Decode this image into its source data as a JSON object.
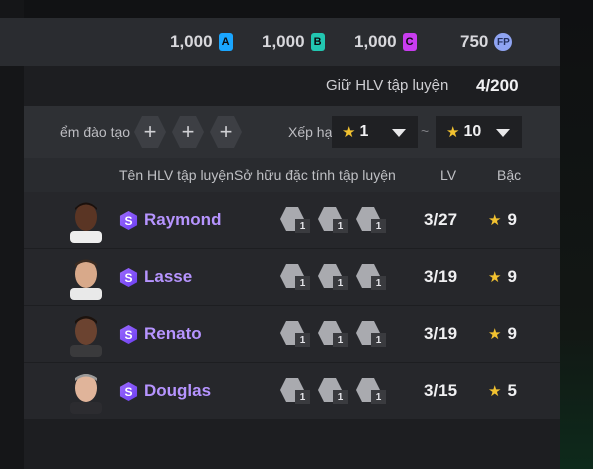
{
  "currencies": [
    {
      "amount": "1,000",
      "badge": "A"
    },
    {
      "amount": "1,000",
      "badge": "B"
    },
    {
      "amount": "1,000",
      "badge": "C"
    },
    {
      "amount": "750",
      "badge": "FP"
    }
  ],
  "hold": {
    "label": "Giữ HLV tập luyện",
    "count": "4/200"
  },
  "filter": {
    "training_slots_label": "ểm đào tạo",
    "plus": "+",
    "sort_label": "Xếp hạ",
    "min": "1",
    "max": "10",
    "tilde": "~",
    "star": "★"
  },
  "headers": {
    "name": "Tên HLV tập luyện",
    "traits": "Sở hữu đặc tính tập luyện",
    "lv": "LV",
    "grade": "Bậc"
  },
  "coaches": [
    {
      "badge": "S",
      "name": "Raymond",
      "lv": "3/27",
      "grade": "9",
      "traits": [
        "1",
        "1",
        "1"
      ]
    },
    {
      "badge": "S",
      "name": "Lasse",
      "lv": "3/19",
      "grade": "9",
      "traits": [
        "1",
        "1",
        "1"
      ]
    },
    {
      "badge": "S",
      "name": "Renato",
      "lv": "3/19",
      "grade": "9",
      "traits": [
        "1",
        "1",
        "1"
      ]
    },
    {
      "badge": "S",
      "name": "Douglas",
      "lv": "3/15",
      "grade": "5",
      "traits": [
        "1",
        "1",
        "1"
      ]
    }
  ],
  "colors": {
    "accent_name": "#b694ff",
    "star": "#f2c230",
    "panel": "#1d1e21"
  }
}
